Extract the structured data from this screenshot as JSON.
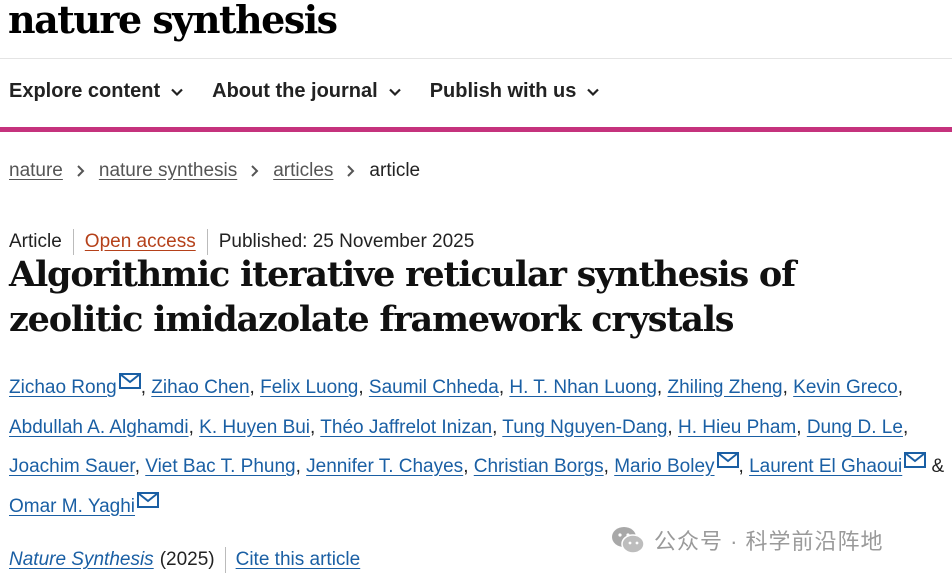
{
  "header": {
    "logo": "nature synthesis"
  },
  "nav": [
    {
      "label": "Explore content"
    },
    {
      "label": "About the journal"
    },
    {
      "label": "Publish with us"
    }
  ],
  "breadcrumb": [
    {
      "label": "nature"
    },
    {
      "label": "nature synthesis"
    },
    {
      "label": "articles"
    },
    {
      "label": "article"
    }
  ],
  "article": {
    "type": "Article",
    "access": "Open access",
    "published": "Published: 25 November 2025",
    "title": "Algorithmic iterative reticular synthesis of zeolitic imidazolate framework crystals",
    "authors": [
      "Zichao Rong",
      "Zihao Chen",
      "Felix Luong",
      "Saumil Chheda",
      "H. T. Nhan Luong",
      "Zhiling Zheng",
      "Kevin Greco",
      "Abdullah A. Alghamdi",
      "K. Huyen Bui",
      "Théo Jaffrelot Inizan",
      "Tung Nguyen-Dang",
      "H. Hieu Pham",
      "Dung D. Le",
      "Joachim Sauer",
      "Viet Bac T. Phung",
      "Jennifer T. Chayes",
      "Christian Borgs",
      "Mario Boley",
      "Laurent El Ghaoui",
      "Omar M. Yaghi"
    ],
    "author_separator": ",",
    "last_author_joiner": "&",
    "journal": "Nature Synthesis",
    "year": "(2025)",
    "cite_label": "Cite this article"
  },
  "watermark": {
    "text": "公众号 · 科学前沿阵地"
  },
  "icons": {
    "nav_chevron": "chevron-down-icon",
    "breadcrumb_sep": "chevron-right-icon",
    "contact": "mail-icon"
  },
  "colors": {
    "accent_bar": "#c5327d",
    "link": "#1a5fa4",
    "open_access": "#b5411a"
  }
}
